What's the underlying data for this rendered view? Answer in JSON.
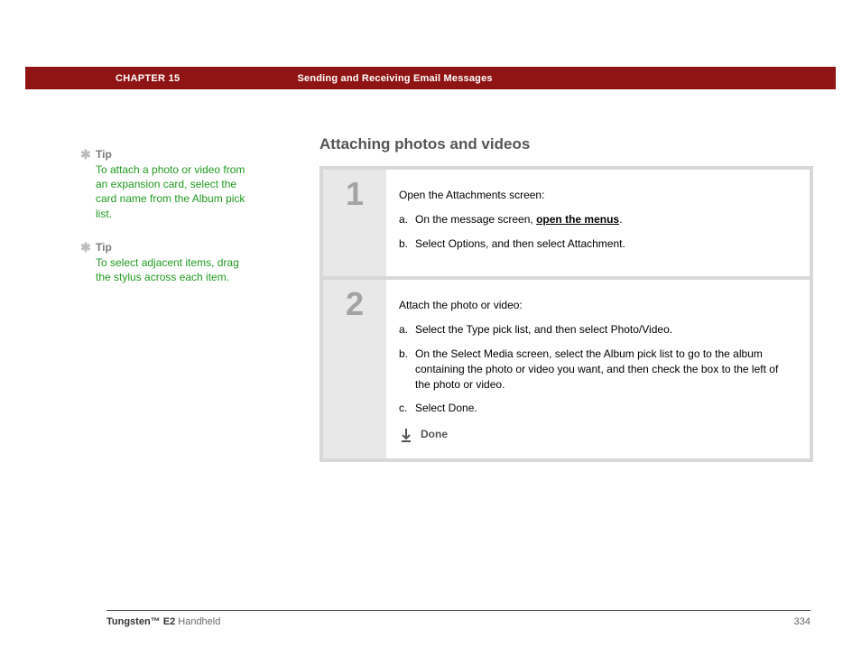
{
  "header": {
    "chapter_label": "CHAPTER 15",
    "chapter_title": "Sending and Receiving Email Messages"
  },
  "sidebar": {
    "tips": [
      {
        "label": "Tip",
        "body": "To attach a photo or video from an expansion card, select the card name from the Album pick list."
      },
      {
        "label": "Tip",
        "body": "To select adjacent items, drag the stylus across each item."
      }
    ]
  },
  "main": {
    "section_title": "Attaching photos and videos",
    "steps": [
      {
        "number": "1",
        "intro": "Open the Attachments screen:",
        "items": [
          {
            "marker": "a.",
            "pre": "On the message screen, ",
            "link": "open the menus",
            "post": "."
          },
          {
            "marker": "b.",
            "pre": "Select Options, and then select Attachment.",
            "link": "",
            "post": ""
          }
        ]
      },
      {
        "number": "2",
        "intro": "Attach the photo or video:",
        "items": [
          {
            "marker": "a.",
            "pre": "Select the Type pick list, and then select Photo/Video.",
            "link": "",
            "post": ""
          },
          {
            "marker": "b.",
            "pre": "On the Select Media screen, select the Album pick list to go to the album containing the photo or video you want, and then check the box to the left of the photo or video.",
            "link": "",
            "post": ""
          },
          {
            "marker": "c.",
            "pre": "Select Done.",
            "link": "",
            "post": ""
          }
        ],
        "done_label": "Done"
      }
    ]
  },
  "footer": {
    "product_strong": "Tungsten™ E2",
    "product_rest": " Handheld",
    "page": "334"
  }
}
